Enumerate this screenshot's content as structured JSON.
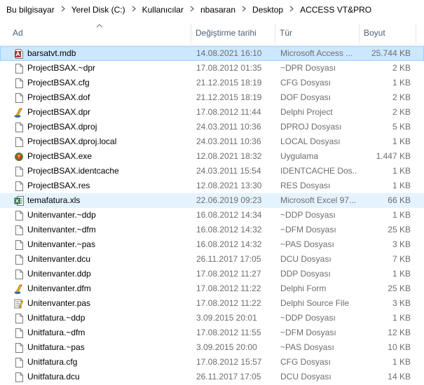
{
  "breadcrumb": [
    "Bu bilgisayar",
    "Yerel Disk (C:)",
    "Kullanıcılar",
    "nbasaran",
    "Desktop",
    "ACCESS VT&PRO"
  ],
  "columns": {
    "name": "Ad",
    "date": "Değiştirme tarihi",
    "type": "Tür",
    "size": "Boyut"
  },
  "files": [
    {
      "name": "barsatvt.mdb",
      "date": "14.08.2021 16:10",
      "type": "Microsoft Access ...",
      "size": "25.744 KB",
      "icon": "access-icon",
      "state": "selected"
    },
    {
      "name": "ProjectBSAX.~dpr",
      "date": "17.08.2012 01:35",
      "type": "~DPR Dosyası",
      "size": "2 KB",
      "icon": "file-icon"
    },
    {
      "name": "ProjectBSAX.cfg",
      "date": "21.12.2015 18:19",
      "type": "CFG Dosyası",
      "size": "1 KB",
      "icon": "file-icon"
    },
    {
      "name": "ProjectBSAX.dof",
      "date": "21.12.2015 18:19",
      "type": "DOF Dosyası",
      "size": "2 KB",
      "icon": "file-icon"
    },
    {
      "name": "ProjectBSAX.dpr",
      "date": "17.08.2012 11:44",
      "type": "Delphi Project",
      "size": "2 KB",
      "icon": "delphi-icon"
    },
    {
      "name": "ProjectBSAX.dproj",
      "date": "24.03.2011 10:36",
      "type": "DPROJ Dosyası",
      "size": "5 KB",
      "icon": "file-icon"
    },
    {
      "name": "ProjectBSAX.dproj.local",
      "date": "24.03.2011 10:36",
      "type": "LOCAL Dosyası",
      "size": "1 KB",
      "icon": "file-icon"
    },
    {
      "name": "ProjectBSAX.exe",
      "date": "12.08.2021 18:32",
      "type": "Uygulama",
      "size": "1.447 KB",
      "icon": "exe-icon"
    },
    {
      "name": "ProjectBSAX.identcache",
      "date": "24.03.2011 15:54",
      "type": "IDENTCACHE Dos...",
      "size": "1 KB",
      "icon": "file-icon"
    },
    {
      "name": "ProjectBSAX.res",
      "date": "12.08.2021 13:30",
      "type": "RES Dosyası",
      "size": "1 KB",
      "icon": "file-icon"
    },
    {
      "name": "temafatura.xls",
      "date": "22.06.2019 09:23",
      "type": "Microsoft Excel 97...",
      "size": "66 KB",
      "icon": "excel-icon",
      "state": "hover"
    },
    {
      "name": "Unitenvanter.~ddp",
      "date": "16.08.2012 14:34",
      "type": "~DDP Dosyası",
      "size": "1 KB",
      "icon": "file-icon"
    },
    {
      "name": "Unitenvanter.~dfm",
      "date": "16.08.2012 14:32",
      "type": "~DFM Dosyası",
      "size": "25 KB",
      "icon": "file-icon"
    },
    {
      "name": "Unitenvanter.~pas",
      "date": "16.08.2012 14:32",
      "type": "~PAS Dosyası",
      "size": "3 KB",
      "icon": "file-icon"
    },
    {
      "name": "Unitenvanter.dcu",
      "date": "26.11.2017 17:05",
      "type": "DCU Dosyası",
      "size": "7 KB",
      "icon": "file-icon"
    },
    {
      "name": "Unitenvanter.ddp",
      "date": "17.08.2012 11:27",
      "type": "DDP Dosyası",
      "size": "1 KB",
      "icon": "file-icon"
    },
    {
      "name": "Unitenvanter.dfm",
      "date": "17.08.2012 11:22",
      "type": "Delphi Form",
      "size": "25 KB",
      "icon": "delphi-icon"
    },
    {
      "name": "Unitenvanter.pas",
      "date": "17.08.2012 11:22",
      "type": "Delphi Source File",
      "size": "3 KB",
      "icon": "pas-icon"
    },
    {
      "name": "Unitfatura.~ddp",
      "date": "3.09.2015 20:01",
      "type": "~DDP Dosyası",
      "size": "1 KB",
      "icon": "file-icon"
    },
    {
      "name": "Unitfatura.~dfm",
      "date": "17.08.2012 11:55",
      "type": "~DFM Dosyası",
      "size": "12 KB",
      "icon": "file-icon"
    },
    {
      "name": "Unitfatura.~pas",
      "date": "3.09.2015 20:00",
      "type": "~PAS Dosyası",
      "size": "10 KB",
      "icon": "file-icon"
    },
    {
      "name": "Unitfatura.cfg",
      "date": "17.08.2012 15:57",
      "type": "CFG Dosyası",
      "size": "1 KB",
      "icon": "file-icon"
    },
    {
      "name": "Unitfatura.dcu",
      "date": "26.11.2017 17:05",
      "type": "DCU Dosyası",
      "size": "14 KB",
      "icon": "file-icon"
    }
  ]
}
